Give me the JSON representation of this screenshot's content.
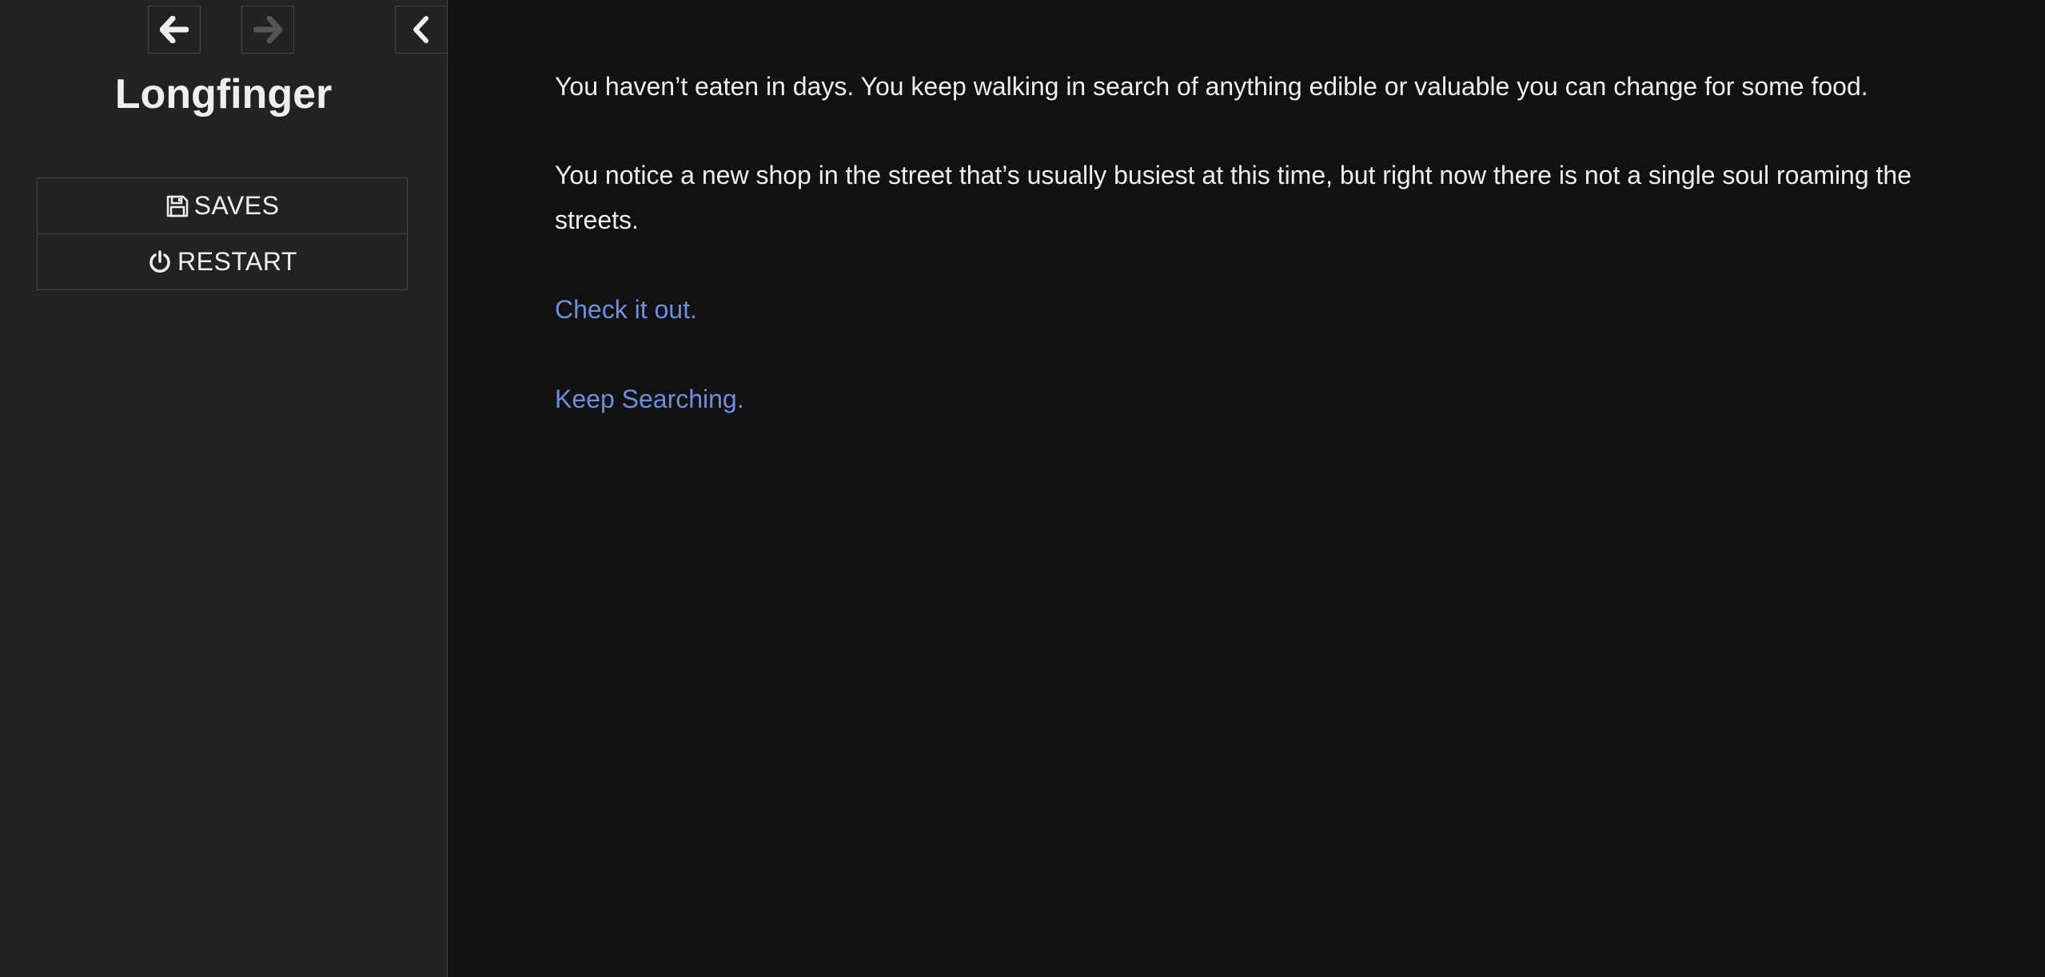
{
  "sidebar": {
    "title": "Longfinger",
    "nav": {
      "back_icon": "arrow-left-icon",
      "forward_icon": "arrow-right-icon",
      "toggle_icon": "chevron-left-icon"
    },
    "menu": [
      {
        "label": "SAVES",
        "icon": "floppy-disk-icon"
      },
      {
        "label": "RESTART",
        "icon": "power-icon"
      }
    ]
  },
  "passage": {
    "paragraphs": [
      "You haven’t eaten in days. You keep walking in search of anything edible or valuable you can change for some food.",
      "You notice a new shop in the street that’s usually busiest at this time, but right now there is not a single soul roaming the streets."
    ],
    "choices": [
      {
        "label": "Check it out."
      },
      {
        "label": "Keep Searching."
      }
    ]
  },
  "colors": {
    "background": "#111111",
    "sidebar": "#222222",
    "text": "#eeeeee",
    "link": "#6b8edf",
    "disabled": "#555555"
  }
}
